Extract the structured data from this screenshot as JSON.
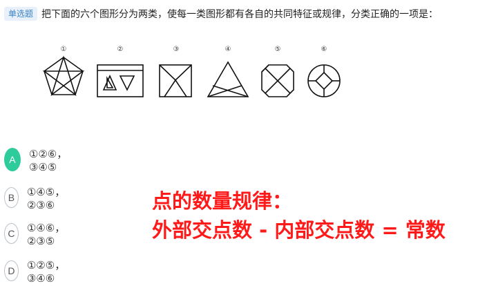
{
  "question": {
    "type_tag": "单选题",
    "text": "把下面的六个图形分为两类，使每一类图形都有各自的共同特征或规律，分类正确的一项是："
  },
  "figures": [
    {
      "number": "①",
      "icon": "pentagon-star-icon"
    },
    {
      "number": "②",
      "icon": "rectangle-triangles-icon"
    },
    {
      "number": "③",
      "icon": "square-v-icon"
    },
    {
      "number": "④",
      "icon": "triangle-crossed-icon"
    },
    {
      "number": "⑤",
      "icon": "octagon-x-icon"
    },
    {
      "number": "⑥",
      "icon": "circle-diamond-icon"
    }
  ],
  "options": [
    {
      "letter": "A",
      "text": "①②⑥，③④⑤",
      "selected": true
    },
    {
      "letter": "B",
      "text": "①④⑤，②③⑥",
      "selected": false
    },
    {
      "letter": "C",
      "text": "①④⑥，②③⑤",
      "selected": false
    },
    {
      "letter": "D",
      "text": "①②⑤，③④⑥",
      "selected": false
    }
  ],
  "annotation": {
    "line1": "点的数量规律：",
    "line2": "外部交点数 - 内部交点数 = 常数"
  },
  "colors": {
    "selected": "#2ecc9a",
    "annotation": "#ff1a1a",
    "tag_bg": "#e8f1fb",
    "tag_text": "#3b82c4"
  }
}
